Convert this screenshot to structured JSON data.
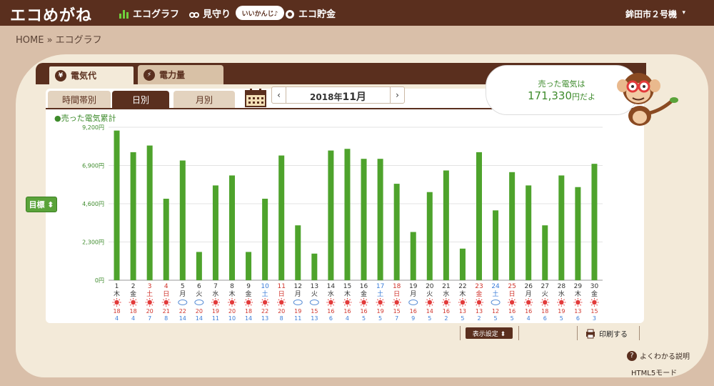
{
  "header": {
    "logo": "エコめがね",
    "nav": [
      {
        "label": "エコグラフ",
        "icon": "bar-chart-icon"
      },
      {
        "label": "見守り",
        "icon": "binoculars-icon"
      },
      {
        "label": "エコ貯金",
        "icon": "piggy-bank-icon"
      }
    ],
    "pill": "いいかんじ♪",
    "device": "鉾田市２号機",
    "device_caret": "▾"
  },
  "breadcrumb": "HOME » エコグラフ",
  "tabs": [
    {
      "label": "電気代",
      "icon": "¥",
      "active": true
    },
    {
      "label": "電力量",
      "icon": "⚡",
      "active": false
    }
  ],
  "subtabs": [
    {
      "label": "時間帯別",
      "active": false
    },
    {
      "label": "日別",
      "active": true
    },
    {
      "label": "月別",
      "active": false
    }
  ],
  "date_nav": {
    "prev": "‹",
    "next": "›",
    "year": "2018年",
    "month": "11月"
  },
  "speech": {
    "line1": "売った電気は",
    "amount": "171,330",
    "unit": "円だよ"
  },
  "legend": "●売った電気累計",
  "goal_button": "目標 ⬍",
  "chart_data": {
    "type": "bar",
    "title": "",
    "xlabel": "",
    "ylabel": "",
    "ylim": [
      0,
      9200
    ],
    "y_ticks": [
      "0円",
      "2,300円",
      "4,600円",
      "6,900円",
      "9,200円"
    ],
    "y_tick_values": [
      0,
      2300,
      4600,
      6900,
      9200
    ],
    "color": "#4ea32c",
    "days": [
      "1",
      "2",
      "3",
      "4",
      "5",
      "6",
      "7",
      "8",
      "9",
      "10",
      "11",
      "12",
      "13",
      "14",
      "15",
      "16",
      "17",
      "18",
      "19",
      "20",
      "21",
      "22",
      "23",
      "24",
      "25",
      "26",
      "27",
      "28",
      "29",
      "30"
    ],
    "weekdays": [
      "木",
      "金",
      "土",
      "日",
      "月",
      "火",
      "水",
      "木",
      "金",
      "土",
      "日",
      "月",
      "火",
      "水",
      "木",
      "金",
      "土",
      "日",
      "月",
      "火",
      "水",
      "木",
      "金",
      "土",
      "日",
      "月",
      "火",
      "水",
      "木",
      "金"
    ],
    "day_colors": [
      "#333",
      "#333",
      "#d0342c",
      "#d0342c",
      "#333",
      "#333",
      "#333",
      "#333",
      "#333",
      "#3b7dd8",
      "#d0342c",
      "#333",
      "#333",
      "#333",
      "#333",
      "#333",
      "#3b7dd8",
      "#d0342c",
      "#333",
      "#333",
      "#333",
      "#333",
      "#d0342c",
      "#3b7dd8",
      "#d0342c",
      "#333",
      "#333",
      "#333",
      "#333",
      "#333"
    ],
    "values": [
      9000,
      7700,
      8100,
      4900,
      7200,
      1700,
      5700,
      6300,
      1700,
      4900,
      7500,
      3300,
      1600,
      7800,
      7900,
      7300,
      7300,
      5800,
      2900,
      5300,
      6600,
      1900,
      7700,
      4200,
      6500,
      5700,
      3300,
      6300,
      5600,
      7000
    ],
    "weather": [
      "sun",
      "sun",
      "sun",
      "sun",
      "cloud",
      "cloud",
      "sun",
      "sun",
      "sun",
      "sun",
      "sun",
      "cloud",
      "cloud",
      "sun",
      "sun",
      "sun",
      "sun",
      "sun",
      "cloud",
      "sun",
      "sun",
      "sun",
      "sun",
      "cloud",
      "sun",
      "sun",
      "sun",
      "sun",
      "sun",
      "sun"
    ],
    "temp_high": [
      "18",
      "18",
      "20",
      "21",
      "22",
      "20",
      "19",
      "20",
      "18",
      "22",
      "20",
      "19",
      "15",
      "16",
      "16",
      "16",
      "19",
      "15",
      "16",
      "14",
      "16",
      "13",
      "13",
      "12",
      "16",
      "16",
      "18",
      "19",
      "13",
      "15"
    ],
    "temp_low": [
      "4",
      "4",
      "7",
      "8",
      "14",
      "14",
      "11",
      "10",
      "14",
      "13",
      "8",
      "11",
      "13",
      "6",
      "4",
      "5",
      "5",
      "7",
      "9",
      "5",
      "2",
      "5",
      "2",
      "5",
      "5",
      "4",
      "6",
      "5",
      "6",
      "3"
    ]
  },
  "footer": {
    "settings": "表示設定 ⬍",
    "print": "印刷する",
    "help": "よくわかる説明",
    "html5": "HTML5モード"
  }
}
